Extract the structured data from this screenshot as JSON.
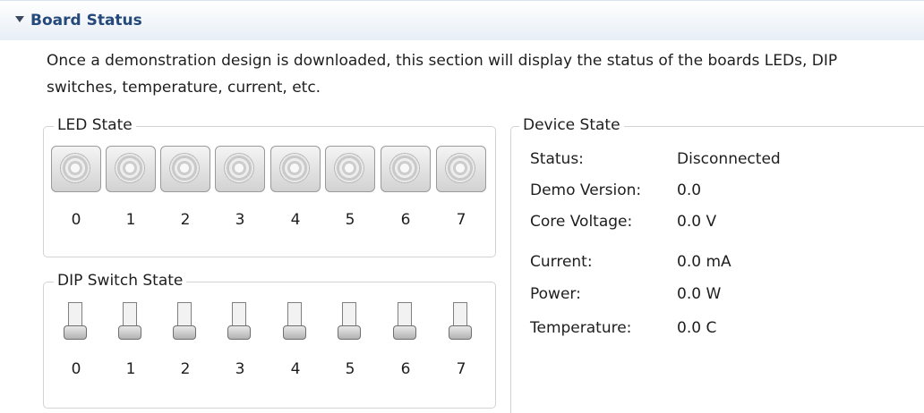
{
  "section": {
    "title": "Board Status",
    "description": "Once a demonstration design is downloaded, this section will display the status of the boards LEDs, DIP switches, temperature, current, etc."
  },
  "led_state": {
    "title": "LED State",
    "leds": [
      {
        "label": "0",
        "on": false
      },
      {
        "label": "1",
        "on": false
      },
      {
        "label": "2",
        "on": false
      },
      {
        "label": "3",
        "on": false
      },
      {
        "label": "4",
        "on": false
      },
      {
        "label": "5",
        "on": false
      },
      {
        "label": "6",
        "on": false
      },
      {
        "label": "7",
        "on": false
      }
    ]
  },
  "dip_state": {
    "title": "DIP Switch State",
    "switches": [
      {
        "label": "0",
        "position": "down"
      },
      {
        "label": "1",
        "position": "down"
      },
      {
        "label": "2",
        "position": "down"
      },
      {
        "label": "3",
        "position": "down"
      },
      {
        "label": "4",
        "position": "down"
      },
      {
        "label": "5",
        "position": "down"
      },
      {
        "label": "6",
        "position": "down"
      },
      {
        "label": "7",
        "position": "down"
      }
    ]
  },
  "device_state": {
    "title": "Device State",
    "rows": [
      {
        "label": "Status:",
        "value": "Disconnected"
      },
      {
        "label": "Demo Version:",
        "value": "0.0"
      },
      {
        "label": "Core Voltage:",
        "value": "0.0 V"
      },
      {
        "label": "Current:",
        "value": "0.0 mA"
      },
      {
        "label": "Power:",
        "value": "0.0 W"
      },
      {
        "label": "Temperature:",
        "value": "0.0 C"
      }
    ]
  },
  "colors": {
    "header_title": "#24497a",
    "header_gradient_end": "#e7eef6",
    "group_border": "#d3d3d3"
  }
}
